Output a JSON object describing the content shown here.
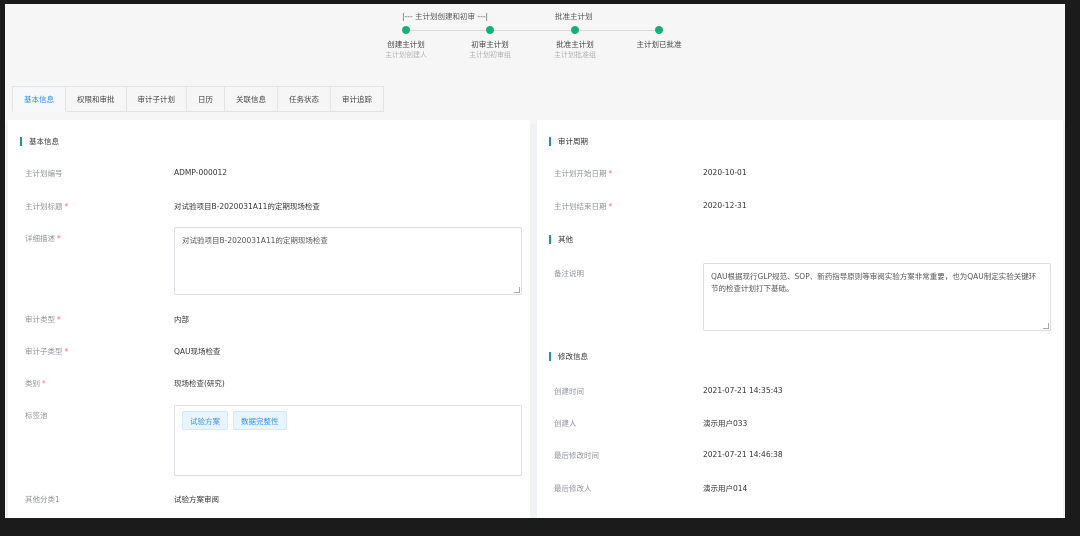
{
  "steps": {
    "segment_labels": [
      "|--- 主计划创建和初审 ---|",
      "批准主计划"
    ],
    "items": [
      {
        "title": "创建主计划",
        "sub": "主计划创建人"
      },
      {
        "title": "初审主计划",
        "sub": "主计划初审组"
      },
      {
        "title": "批准主计划",
        "sub": "主计划批准组"
      },
      {
        "title": "主计划已批准",
        "sub": ""
      }
    ],
    "accent_color": "#13b07c"
  },
  "tabs": [
    "基本信息",
    "权限和审批",
    "审计子计划",
    "日历",
    "关联信息",
    "任务状态",
    "审计追踪"
  ],
  "active_tab": "基本信息",
  "basic": {
    "section_title": "基本信息",
    "fields": {
      "plan_no": {
        "label": "主计划编号",
        "value": "ADMP-000012"
      },
      "plan_title": {
        "label": "主计划标题",
        "value": "对试验项目B-2020031A11的定期现场检查"
      },
      "detail": {
        "label": "详细描述",
        "value": "对试验项目B-2020031A11的定期现场检查"
      },
      "audit_type": {
        "label": "审计类型",
        "value": "内部"
      },
      "audit_subtype": {
        "label": "审计子类型",
        "value": "QAU现场检查"
      },
      "category": {
        "label": "类别",
        "value": "现场检查(研究)"
      },
      "tags": {
        "label": "标签池",
        "values": [
          "试验方案",
          "数据完整性"
        ]
      },
      "other_cat": {
        "label": "其他分类1",
        "value": "试验方案审阅"
      }
    }
  },
  "cycle": {
    "section_title": "审计周期",
    "start": {
      "label": "主计划开始日期",
      "value": "2020-10-01"
    },
    "end": {
      "label": "主计划结束日期",
      "value": "2020-12-31"
    }
  },
  "other": {
    "section_title": "其他",
    "remark": {
      "label": "备注说明",
      "value": "QAU根据现行GLP规范、SOP、新药指导原则等审阅实验方案非常重要，也为QAU制定实验关键环节的检查计划打下基础。"
    }
  },
  "modify": {
    "section_title": "修改信息",
    "created_time": {
      "label": "创建时间",
      "value": "2021-07-21 14:35:43"
    },
    "creator": {
      "label": "创建人",
      "value": "演示用户033"
    },
    "modified_time": {
      "label": "最后修改时间",
      "value": "2021-07-21 14:46:38"
    },
    "modifier": {
      "label": "最后修改人",
      "value": "演示用户014"
    }
  },
  "required_mark": "*",
  "colors": {
    "accent": "#1a9a8e",
    "tab_active": "#2f8ae6",
    "required": "#f56c6c",
    "tag_text": "#3c8fe6"
  }
}
